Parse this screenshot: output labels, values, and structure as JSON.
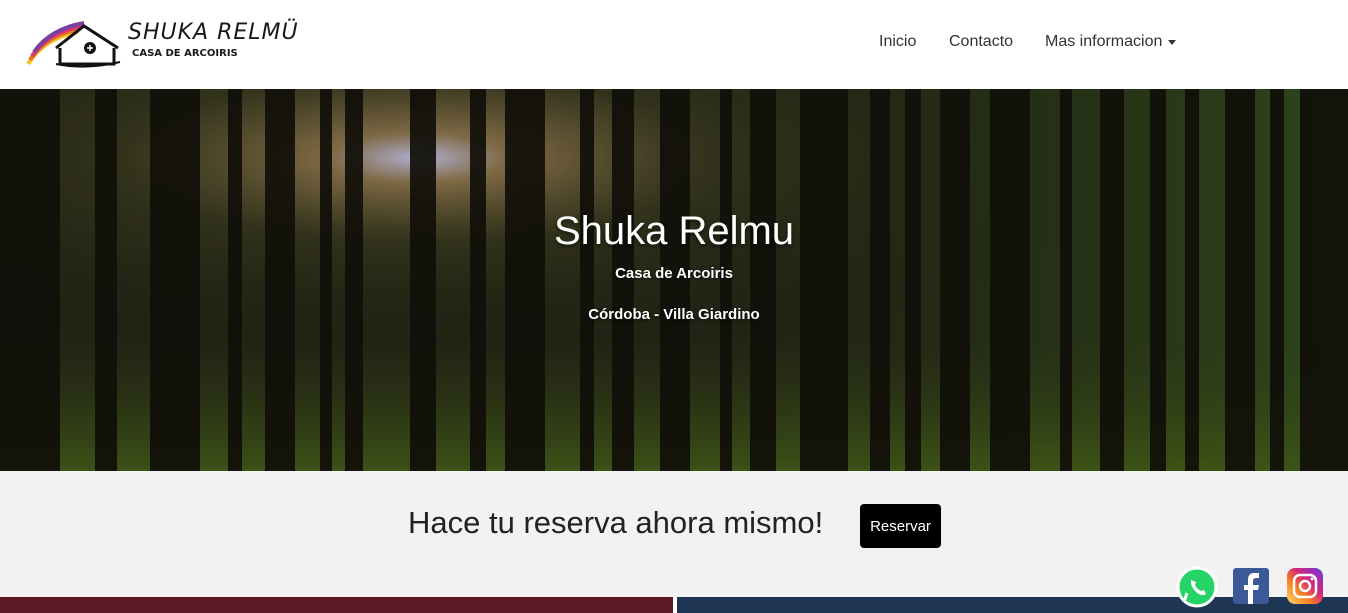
{
  "brand": {
    "name": "SHUKA RELMÜ",
    "subtitle": "CASA DE ARCOIRIS",
    "logo_icon": "house-rainbow-icon"
  },
  "nav": {
    "items": [
      {
        "label": "Inicio"
      },
      {
        "label": "Contacto"
      },
      {
        "label": "Mas informacion",
        "dropdown": true
      }
    ]
  },
  "hero": {
    "title": "Shuka Relmu",
    "subtitle": "Casa de Arcoiris",
    "location": "Córdoba - Villa Giardino"
  },
  "cta": {
    "text": "Hace tu reserva ahora mismo!",
    "button_label": "Reservar"
  },
  "social": [
    {
      "name": "whatsapp-icon",
      "color": "#25D366"
    },
    {
      "name": "facebook-icon",
      "color": "#3b5998"
    },
    {
      "name": "instagram-icon",
      "color": "#C13584"
    }
  ],
  "colors": {
    "navbar_bg": "#ffffff",
    "cta_bg": "#f2f2f2",
    "button_bg": "#000000",
    "hero_text": "#ffffff"
  }
}
